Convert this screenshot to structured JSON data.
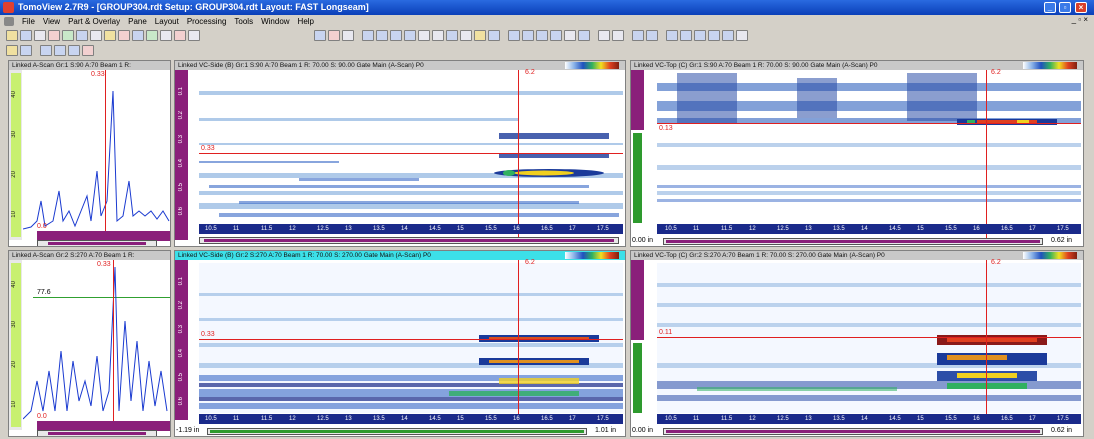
{
  "window": {
    "title": "TomoView 2.7R9 - [GROUP304.rdt  Setup: GROUP304.rdt  Layout: FAST Longseam]",
    "controls": [
      "_",
      "▫",
      "×"
    ]
  },
  "menu": {
    "items": [
      "File",
      "View",
      "Part & Overlay",
      "Pane",
      "Layout",
      "Processing",
      "Tools",
      "Window",
      "Help"
    ],
    "mdi_controls": "_ ▫ ×"
  },
  "panels": {
    "ascan_top": {
      "title": "Linked A-Scan Gr:1 S:90 A:70 Beam 1  R:",
      "cursor_label": "0.33",
      "zero_label": "0.0",
      "scale_labels": [
        "10",
        "20",
        "30",
        "40"
      ]
    },
    "vcside_top": {
      "title": "Linked VC-Side (B) Gr:1 S:90 A:70 Beam 1  R: 70.00 S: 90.00 Gate Main (A-Scan) P0",
      "cursor_x_label": "6.2",
      "cursor_y_label": "0.33",
      "depth_labels": [
        "0.1",
        "0.2",
        "0.3",
        "0.4",
        "0.5",
        "0.6"
      ],
      "ticks": [
        "10.5",
        "11",
        "11.5",
        "12",
        "12.5",
        "13",
        "13.5",
        "14",
        "14.5",
        "15",
        "15.5",
        "16",
        "16.5",
        "17",
        "17.5"
      ]
    },
    "vctop_top": {
      "title": "Linked VC-Top (C) Gr:1 S:90 A:70 Beam 1  R: 70.00 S: 90.00 Gate Main (A-Scan) P0",
      "cursor_x_label": "6.2",
      "cursor_y_label": "0.13",
      "left_value": "0.00 in",
      "right_value": "0.62 in",
      "ticks": [
        "10.5",
        "11",
        "11.5",
        "12",
        "12.5",
        "13",
        "13.5",
        "14",
        "14.5",
        "15",
        "15.5",
        "16",
        "16.5",
        "17",
        "17.5"
      ]
    },
    "ascan_bot": {
      "title": "Linked A-Scan Gr:2 S:270 A:70 Beam 1  R:",
      "cursor_label": "0.33",
      "level_label": "77.6",
      "zero_label": "0.0",
      "scale_labels": [
        "10",
        "20",
        "30",
        "40"
      ]
    },
    "vcside_bot": {
      "title": "Linked VC-Side (B) Gr:2 S:270 A:70 Beam 1  R: 70.00 S: 270.00 Gate Main (A-Scan) P0",
      "cursor_x_label": "6.2",
      "cursor_y_label": "0.33",
      "left_value": "-1.19 in",
      "right_value": "1.01 in",
      "depth_labels": [
        "0.1",
        "0.2",
        "0.3",
        "0.4",
        "0.5",
        "0.6"
      ],
      "ticks": [
        "10.5",
        "11",
        "11.5",
        "12",
        "12.5",
        "13",
        "13.5",
        "14",
        "14.5",
        "15",
        "15.5",
        "16",
        "16.5",
        "17",
        "17.5"
      ]
    },
    "vctop_bot": {
      "title": "Linked VC-Top (C) Gr:2 S:270 A:70 Beam 1  R: 70.00 S: 270.00 Gate Main (A-Scan) P0",
      "cursor_x_label": "6.2",
      "cursor_y_label": "0.11",
      "left_value": "0.00 in",
      "right_value": "0.62 in",
      "ticks": [
        "10.5",
        "11",
        "11.5",
        "12",
        "12.5",
        "13",
        "13.5",
        "14",
        "14.5",
        "15",
        "15.5",
        "16",
        "16.5",
        "17",
        "17.5"
      ]
    }
  },
  "colors": {
    "title_bar": "#0a3fb8",
    "active_pane_title": "#3ce0e8",
    "cursor": "#e02020",
    "ruler_purple": "#8a1f7a",
    "ruler_green": "#2e9a2e",
    "ruler_blue": "#1a2a8a"
  }
}
